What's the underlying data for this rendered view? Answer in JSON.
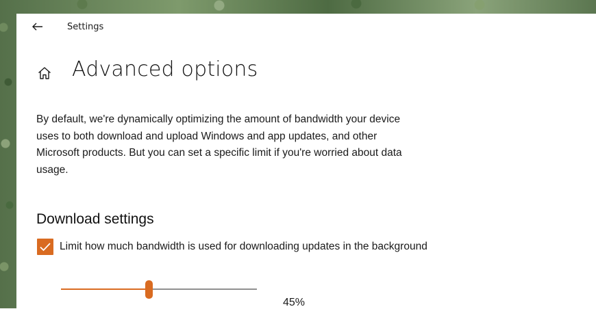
{
  "window": {
    "app_title": "Settings",
    "back_icon": "back-arrow-icon",
    "home_icon": "home-icon"
  },
  "page": {
    "title": "Advanced options",
    "description": "By default, we're dynamically optimizing the amount of bandwidth your device uses to both download and upload Windows and app updates, and other Microsoft products. But you can set a specific limit if you're worried about data usage."
  },
  "download_settings": {
    "section_title": "Download settings",
    "limit_checkbox": {
      "checked": true,
      "label": "Limit how much bandwidth is used for downloading updates in the background"
    },
    "slider": {
      "value": 45,
      "min": 0,
      "max": 100,
      "value_label": "45%"
    }
  },
  "colors": {
    "accent": "#d96b21",
    "track": "#8f8f8f",
    "text": "#1a1a1a",
    "background": "#ffffff"
  }
}
